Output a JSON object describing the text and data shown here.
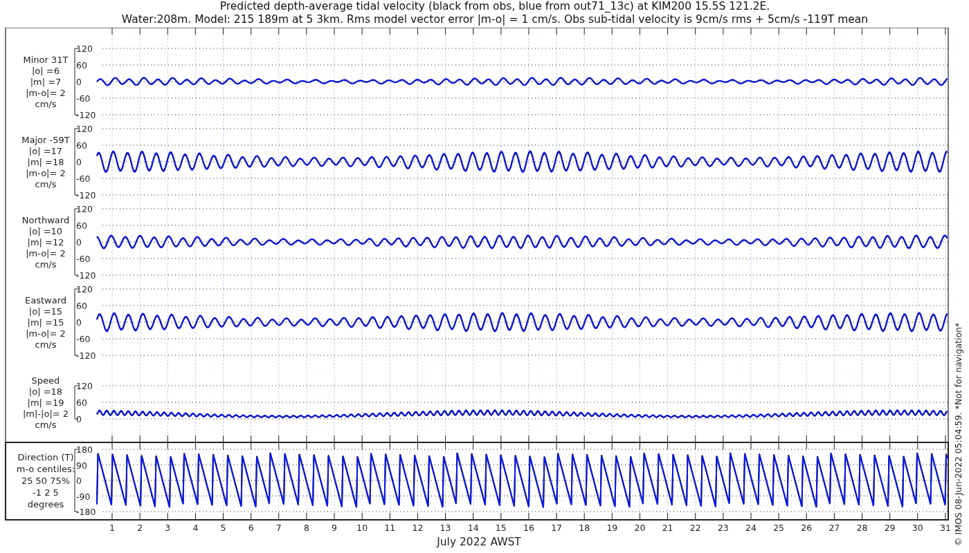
{
  "title": [
    "Predicted depth-average tidal velocity (black from obs, blue from out71_13c) at KIM200 15.5S 121.2E.",
    "Water:208m. Model: 215 189m at 5 3km. Rms model vector error |m-o| = 1 cm/s. Obs sub-tidal velocity is 9cm/s rms + 5cm/s -119T mean"
  ],
  "panels": [
    {
      "kind": "velocity",
      "label_lines": [
        "Minor 31T",
        "|o| =6",
        "|m| =7",
        "|m-o|= 2",
        "cm/s"
      ],
      "yticks": [
        "120",
        "60",
        "0",
        "-60",
        "-120"
      ]
    },
    {
      "kind": "velocity",
      "label_lines": [
        "Major -59T",
        "|o| =17",
        "|m| =18",
        "|m-o|= 2",
        "cm/s"
      ],
      "yticks": [
        "120",
        "60",
        "0",
        "-60",
        "-120"
      ]
    },
    {
      "kind": "velocity",
      "label_lines": [
        "Northward",
        "|o| =10",
        "|m| =12",
        "|m-o|= 2",
        "cm/s"
      ],
      "yticks": [
        "120",
        "60",
        "0",
        "-60",
        "-120"
      ]
    },
    {
      "kind": "velocity",
      "label_lines": [
        "Eastward",
        "|o| =15",
        "|m| =15",
        "|m-o|= 2",
        "cm/s"
      ],
      "yticks": [
        "120",
        "60",
        "0",
        "-60",
        "-120"
      ]
    },
    {
      "kind": "speed",
      "label_lines": [
        "Speed",
        "|o| =18",
        "|m| =19",
        "|m|-|o|= 2",
        "cm/s"
      ],
      "yticks": [
        "120",
        "60",
        "0"
      ]
    },
    {
      "kind": "direction",
      "label_lines": [
        "Direction (T)",
        "m-o centiles:",
        "25  50  75%",
        "-1  2  5",
        "degrees"
      ],
      "yticks": [
        "180",
        "90",
        "0",
        "-90",
        "-180"
      ]
    }
  ],
  "x_axis": {
    "ticks": [
      "1",
      "2",
      "3",
      "4",
      "5",
      "6",
      "7",
      "8",
      "9",
      "10",
      "11",
      "12",
      "13",
      "14",
      "15",
      "16",
      "17",
      "18",
      "19",
      "20",
      "21",
      "22",
      "23",
      "24",
      "25",
      "26",
      "27",
      "28",
      "29",
      "30",
      "31"
    ],
    "label": "July 2022 AWST"
  },
  "credit": "© IMOS 08-Jun-2022 05:04:59.  *Not for navigation*"
}
